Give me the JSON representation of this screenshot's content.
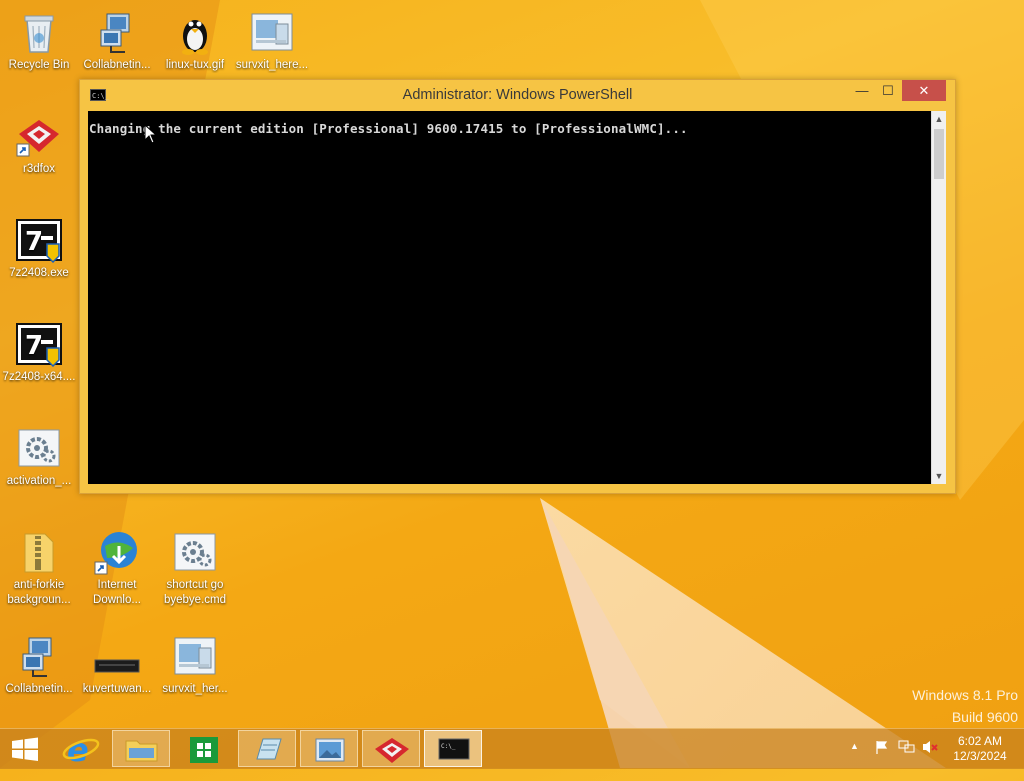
{
  "desktop": {
    "icons": [
      {
        "label": "Recycle Bin",
        "icon": "recycle-bin-icon"
      },
      {
        "label": "Collabnetin...",
        "icon": "network-computer-icon"
      },
      {
        "label": "linux-tux.gif",
        "icon": "tux-penguin-icon"
      },
      {
        "label": "survxit_here...",
        "icon": "window-file-icon"
      },
      {
        "label": "r3dfox",
        "icon": "r3dfox-icon"
      },
      {
        "label": "7z2408.exe",
        "icon": "seven-zip-icon"
      },
      {
        "label": "7z2408-x64....",
        "icon": "seven-zip-icon"
      },
      {
        "label": "activation_...",
        "icon": "gear-file-icon"
      },
      {
        "label": "anti-forkie backgroun...",
        "icon": "zip-folder-icon"
      },
      {
        "label": "Internet Downlo...",
        "icon": "download-manager-icon"
      },
      {
        "label": "shortcut go byebye.cmd",
        "icon": "gear-file-icon"
      },
      {
        "label": "Collabnetin...",
        "icon": "network-computer-icon"
      },
      {
        "label": "kuvertuwan...",
        "icon": "black-bar-icon"
      },
      {
        "label": "survxit_her...",
        "icon": "window-file-icon"
      }
    ],
    "watermark_line1": "Windows 8.1 Pro",
    "watermark_line2": "Build 9600"
  },
  "window": {
    "title": "Administrator: Windows PowerShell",
    "console_text": "Changing the current edition [Professional] 9600.17415 to [ProfessionalWMC]...",
    "app_icon_text": "C:\\_",
    "minimize": "—",
    "maximize": "☐",
    "close": "✕"
  },
  "taskbar": {
    "items": [
      {
        "name": "ie-icon",
        "label": "e"
      },
      {
        "name": "file-explorer-icon",
        "label": ""
      },
      {
        "name": "store-icon",
        "label": ""
      },
      {
        "name": "notebook-icon",
        "label": ""
      },
      {
        "name": "photos-icon",
        "label": ""
      },
      {
        "name": "r3dfox-icon",
        "label": ""
      },
      {
        "name": "powershell-icon",
        "label": "C:\\_"
      }
    ],
    "clock_time": "6:02 AM",
    "clock_date": "12/3/2024"
  },
  "colors": {
    "desktop": "#f6b21c",
    "close_button": "#c7504a",
    "console_bg": "#000000"
  }
}
